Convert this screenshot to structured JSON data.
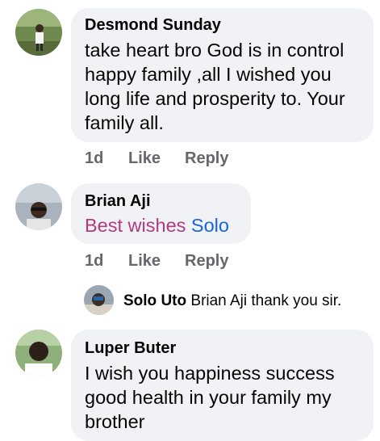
{
  "comments": [
    {
      "author": "Desmond Sunday",
      "text_lines": [
        "take heart bro God is in control",
        "happy family ,all I wished you",
        "long life and prosperity to. Your",
        "family all."
      ],
      "time": "1d",
      "like": "Like",
      "reply": "Reply"
    },
    {
      "author": "Brian Aji",
      "text_prefix": "Best wishes",
      "text_mention": "Solo",
      "time": "1d",
      "like": "Like",
      "reply": "Reply",
      "replies": [
        {
          "author": "Solo Uto",
          "text": "Brian Aji thank you sir."
        }
      ]
    },
    {
      "author": "Luper Buter",
      "text_lines": [
        "I wish you happiness success",
        "good health in your family my",
        "brother"
      ]
    }
  ],
  "colors": {
    "bubble": "#f0f2f5",
    "meta": "#65676b",
    "mention": "#1766d6",
    "highlight": "#b03a84"
  }
}
